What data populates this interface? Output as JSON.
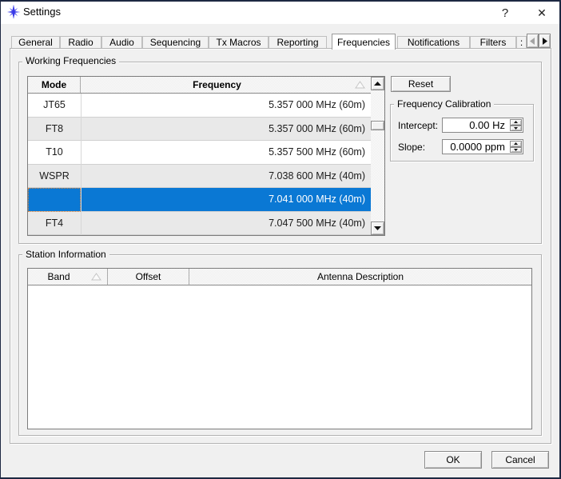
{
  "window": {
    "title": "Settings",
    "help_label": "?",
    "close_label": "✕"
  },
  "colors": {
    "accent": "#0a78d4",
    "selection_text": "#ffffff",
    "window_border": "#1d2842",
    "dialog_bg": "#f0f0f0",
    "titlebar_bg": "#ffffff",
    "focus_dots": "#e2863b",
    "app_icon_blue": "#3a3ae8"
  },
  "tabs": {
    "items": [
      {
        "label": "General"
      },
      {
        "label": "Radio"
      },
      {
        "label": "Audio"
      },
      {
        "label": "Sequencing"
      },
      {
        "label": "Tx Macros"
      },
      {
        "label": "Reporting"
      },
      {
        "label": "Frequencies",
        "selected": true
      },
      {
        "label": "Notifications"
      },
      {
        "label": "Filters"
      },
      {
        "label": ":"
      }
    ],
    "scroll_left": "◀",
    "scroll_right": "▶"
  },
  "working_frequencies": {
    "title": "Working Frequencies",
    "columns": {
      "mode": "Mode",
      "frequency": "Frequency"
    },
    "rows": [
      {
        "mode": "JT65",
        "frequency": "5.357 000 MHz (60m)"
      },
      {
        "mode": "FT8",
        "frequency": "5.357 000 MHz (60m)"
      },
      {
        "mode": "T10",
        "frequency": "5.357 500 MHz (60m)"
      },
      {
        "mode": "WSPR",
        "frequency": "7.038 600 MHz (40m)"
      },
      {
        "mode": "",
        "frequency": "7.041 000 MHz (40m)",
        "selected": true
      },
      {
        "mode": "FT4",
        "frequency": "7.047 500 MHz (40m)"
      }
    ],
    "reset_button": "Reset",
    "calibration": {
      "title": "Frequency Calibration",
      "intercept_label": "Intercept:",
      "intercept_value": "0.00 Hz",
      "slope_label": "Slope:",
      "slope_value": "0.0000 ppm"
    }
  },
  "station_information": {
    "title": "Station Information",
    "columns": {
      "band": "Band",
      "offset": "Offset",
      "antenna": "Antenna Description"
    }
  },
  "buttons": {
    "ok": "OK",
    "cancel": "Cancel"
  }
}
